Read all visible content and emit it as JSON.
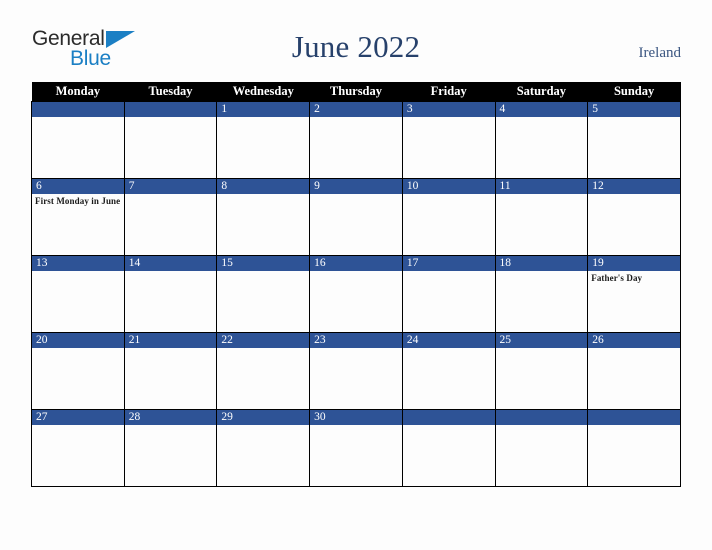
{
  "brand": {
    "name_part1": "General",
    "name_part2": "Blue",
    "triangle_icon": "triangle-icon",
    "color_dark": "#2b2b2b",
    "color_blue": "#1b7fc4"
  },
  "header": {
    "title": "June 2022",
    "region": "Ireland",
    "title_color": "#27416b"
  },
  "calendar": {
    "weekday_headers": [
      "Monday",
      "Tuesday",
      "Wednesday",
      "Thursday",
      "Friday",
      "Saturday",
      "Sunday"
    ],
    "header_bg": "#000000",
    "daynum_bg": "#2e5396",
    "cell_bg": "#fdfdfd",
    "weeks": [
      [
        {
          "day": "",
          "events": []
        },
        {
          "day": "",
          "events": []
        },
        {
          "day": "1",
          "events": []
        },
        {
          "day": "2",
          "events": []
        },
        {
          "day": "3",
          "events": []
        },
        {
          "day": "4",
          "events": []
        },
        {
          "day": "5",
          "events": []
        }
      ],
      [
        {
          "day": "6",
          "events": [
            "First Monday in June"
          ]
        },
        {
          "day": "7",
          "events": []
        },
        {
          "day": "8",
          "events": []
        },
        {
          "day": "9",
          "events": []
        },
        {
          "day": "10",
          "events": []
        },
        {
          "day": "11",
          "events": []
        },
        {
          "day": "12",
          "events": []
        }
      ],
      [
        {
          "day": "13",
          "events": []
        },
        {
          "day": "14",
          "events": []
        },
        {
          "day": "15",
          "events": []
        },
        {
          "day": "16",
          "events": []
        },
        {
          "day": "17",
          "events": []
        },
        {
          "day": "18",
          "events": []
        },
        {
          "day": "19",
          "events": [
            "Father's Day"
          ]
        }
      ],
      [
        {
          "day": "20",
          "events": []
        },
        {
          "day": "21",
          "events": []
        },
        {
          "day": "22",
          "events": []
        },
        {
          "day": "23",
          "events": []
        },
        {
          "day": "24",
          "events": []
        },
        {
          "day": "25",
          "events": []
        },
        {
          "day": "26",
          "events": []
        }
      ],
      [
        {
          "day": "27",
          "events": []
        },
        {
          "day": "28",
          "events": []
        },
        {
          "day": "29",
          "events": []
        },
        {
          "day": "30",
          "events": []
        },
        {
          "day": "",
          "events": []
        },
        {
          "day": "",
          "events": []
        },
        {
          "day": "",
          "events": []
        }
      ]
    ]
  }
}
